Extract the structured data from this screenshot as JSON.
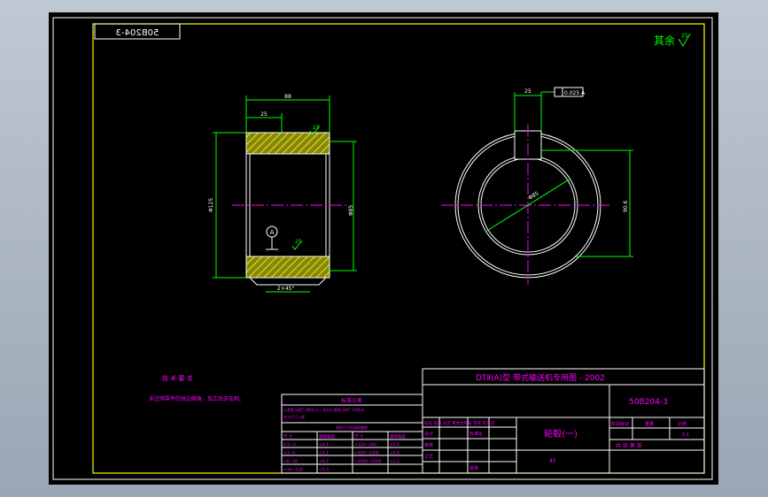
{
  "drawing": {
    "mirror_code": "50B204-3",
    "roughness_note": "其余",
    "roughness_value": "25",
    "colors": {
      "background": "#000000",
      "frame": "#ffff00",
      "outline": "#ffffff",
      "dimension": "#00ff00",
      "text": "#ff00ff",
      "center_line": "#ff00ff",
      "section_fill": "#aaaa00"
    }
  },
  "section_view": {
    "dim_total_length": "88",
    "dim_offset": "25",
    "roughness_top": "25",
    "roughness_bottom": "25",
    "dim_outer_diameter": "Φ125",
    "dim_bore": "Φ85",
    "chamfer": "2×45°",
    "datum_label": "A"
  },
  "end_view": {
    "key_width": "25",
    "tolerance_frame": "0.025 A",
    "bore_label": "Φ85",
    "keyway_depth": "90.6"
  },
  "notes": {
    "heading": "技 术 要 求",
    "line1": "未注明零件的锐边倒角，加工后去毛刺。"
  },
  "title_block": {
    "series_title": "DTⅡ(A)型 带式输送机专用图 - 2002",
    "drawing_number": "50B204-3",
    "part_name": "轮毂(一)",
    "material": "45",
    "labels": {
      "stage_mark": "阶段标记",
      "weight": "重量",
      "scale": "比例",
      "sheet": "共 张 第 张",
      "revision": "标记 处数 分区 更改文件号 签名 年月日",
      "design": "设计",
      "check": "审核",
      "process": "工艺",
      "standard": "标准化",
      "approve": "批准"
    },
    "scale_value": "1:1"
  },
  "tolerance_table": {
    "title": "标准公差",
    "desc1": "公差按 GB/T 1804-m ，形位公差按 GB/T 1184-K",
    "desc2": "未注尺寸公差",
    "subtitle": "线性尺寸的极限偏差",
    "headers": [
      "尺 寸",
      "极限偏差",
      "尺 寸",
      "极限偏差"
    ],
    "rows": [
      [
        "0.5~3",
        "±0.1",
        ">120~400",
        "±0.5"
      ],
      [
        ">3~6",
        "±0.1",
        ">400~1000",
        "±0.8"
      ],
      [
        ">6~30",
        "±0.2",
        ">1000~2000",
        "±1.2"
      ],
      [
        ">30~120",
        "±0.3",
        "",
        ""
      ]
    ]
  }
}
